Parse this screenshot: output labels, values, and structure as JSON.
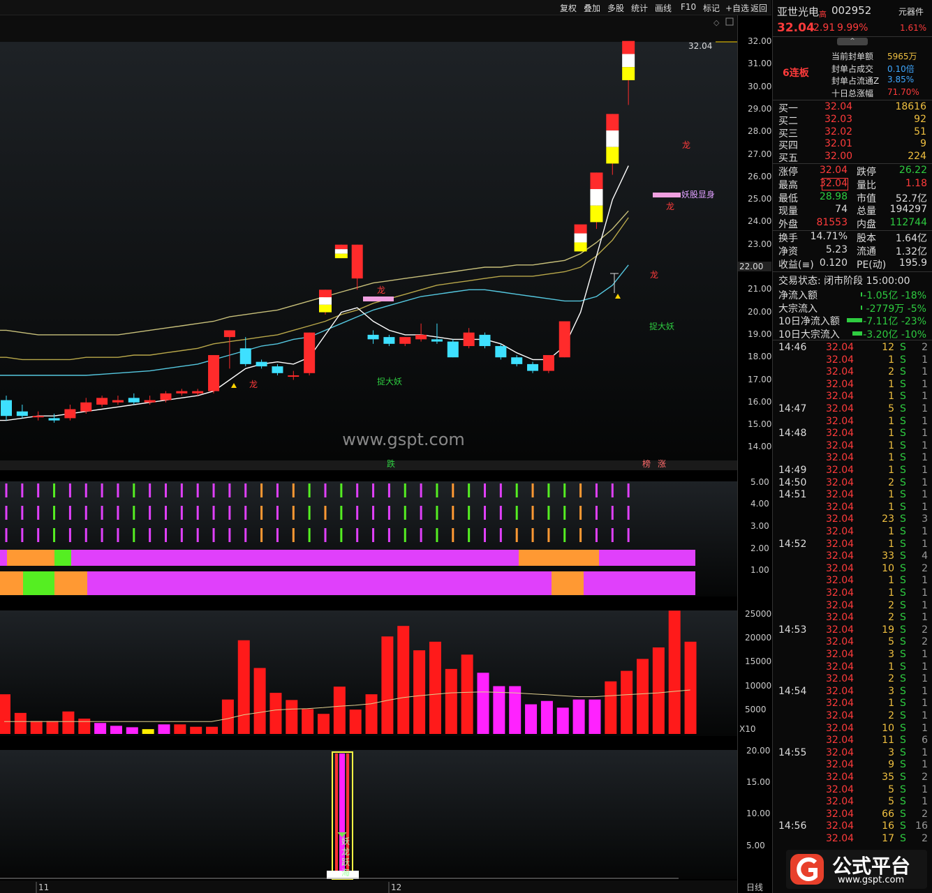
{
  "toolbar": {
    "items": [
      "复权",
      "叠加",
      "多股",
      "统计",
      "画线",
      "F10",
      "标记",
      "+自选",
      "返回"
    ]
  },
  "stock": {
    "name": "亚世光电",
    "tag": "高",
    "code": "002952",
    "sector": "元器件",
    "price": "32.04",
    "change": "2.91",
    "pct": "9.99%",
    "sector_pct": "1.61%"
  },
  "seal": {
    "badge": "6连板",
    "rows": [
      {
        "label": "当前封单额",
        "value": "5965万",
        "color": "gold"
      },
      {
        "label": "封单占成交",
        "value": "0.10倍",
        "color": "blue"
      },
      {
        "label": "封单占流通Z",
        "value": "3.85%",
        "color": "blue"
      },
      {
        "label": "十日总涨幅",
        "value": "71.70%",
        "color": "red"
      }
    ]
  },
  "bids": [
    {
      "label": "买一",
      "price": "32.04",
      "vol": "18616"
    },
    {
      "label": "买二",
      "price": "32.03",
      "vol": "92"
    },
    {
      "label": "买三",
      "price": "32.02",
      "vol": "51"
    },
    {
      "label": "买四",
      "price": "32.01",
      "vol": "9"
    },
    {
      "label": "买五",
      "price": "32.00",
      "vol": "224"
    }
  ],
  "stats1": [
    {
      "l1": "涨停",
      "v1": "32.04",
      "c1": "red",
      "l2": "跌停",
      "v2": "26.22",
      "c2": "green"
    },
    {
      "l1": "最高",
      "v1": "32.04",
      "c1": "red",
      "l2": "量比",
      "v2": "1.18",
      "c2": "red"
    },
    {
      "l1": "最低",
      "v1": "28.98",
      "c1": "green",
      "l2": "市值",
      "v2": "52.7亿",
      "c2": "white"
    },
    {
      "l1": "现量",
      "v1": "74",
      "c1": "white",
      "l2": "总量",
      "v2": "194297",
      "c2": "white"
    },
    {
      "l1": "外盘",
      "v1": "81553",
      "c1": "red",
      "l2": "内盘",
      "v2": "112744",
      "c2": "green"
    }
  ],
  "stats2": [
    {
      "l1": "换手",
      "v1": "14.71%",
      "c1": "white",
      "l2": "股本",
      "v2": "1.64亿",
      "c2": "white"
    },
    {
      "l1": "净资",
      "v1": "5.23",
      "c1": "white",
      "l2": "流通",
      "v2": "1.32亿",
      "c2": "white"
    },
    {
      "l1": "收益(≡)",
      "v1": "0.120",
      "c1": "white",
      "l2": "PE(动)",
      "v2": "195.9",
      "c2": "white"
    }
  ],
  "trade_status": "交易状态: 闭市阶段 15:00:00",
  "flows": [
    {
      "label": "净流入额",
      "value": "-1.05亿 -18%",
      "bar": 2
    },
    {
      "label": "大宗流入",
      "value": "-2779万 -5%",
      "bar": 2
    },
    {
      "label": "10日净流入额",
      "value": "-7.11亿 -23%",
      "bar": 22
    },
    {
      "label": "10日大宗流入",
      "value": "-3.20亿 -10%",
      "bar": 14
    }
  ],
  "ticks": [
    {
      "t": "14:46",
      "p": "32.04",
      "v": "12",
      "s": "S",
      "n": "2"
    },
    {
      "t": "",
      "p": "32.04",
      "v": "1",
      "s": "S",
      "n": "1"
    },
    {
      "t": "",
      "p": "32.04",
      "v": "2",
      "s": "S",
      "n": "1"
    },
    {
      "t": "",
      "p": "32.04",
      "v": "1",
      "s": "S",
      "n": "1"
    },
    {
      "t": "",
      "p": "32.04",
      "v": "1",
      "s": "S",
      "n": "1"
    },
    {
      "t": "14:47",
      "p": "32.04",
      "v": "5",
      "s": "S",
      "n": "1"
    },
    {
      "t": "",
      "p": "32.04",
      "v": "1",
      "s": "S",
      "n": "1"
    },
    {
      "t": "14:48",
      "p": "32.04",
      "v": "1",
      "s": "S",
      "n": "1"
    },
    {
      "t": "",
      "p": "32.04",
      "v": "1",
      "s": "S",
      "n": "1"
    },
    {
      "t": "",
      "p": "32.04",
      "v": "1",
      "s": "S",
      "n": "1"
    },
    {
      "t": "14:49",
      "p": "32.04",
      "v": "1",
      "s": "S",
      "n": "1"
    },
    {
      "t": "14:50",
      "p": "32.04",
      "v": "2",
      "s": "S",
      "n": "1"
    },
    {
      "t": "14:51",
      "p": "32.04",
      "v": "1",
      "s": "S",
      "n": "1"
    },
    {
      "t": "",
      "p": "32.04",
      "v": "1",
      "s": "S",
      "n": "1"
    },
    {
      "t": "",
      "p": "32.04",
      "v": "23",
      "s": "S",
      "n": "3"
    },
    {
      "t": "",
      "p": "32.04",
      "v": "1",
      "s": "S",
      "n": "1"
    },
    {
      "t": "14:52",
      "p": "32.04",
      "v": "1",
      "s": "S",
      "n": "1"
    },
    {
      "t": "",
      "p": "32.04",
      "v": "33",
      "s": "S",
      "n": "4"
    },
    {
      "t": "",
      "p": "32.04",
      "v": "10",
      "s": "S",
      "n": "2"
    },
    {
      "t": "",
      "p": "32.04",
      "v": "1",
      "s": "S",
      "n": "1"
    },
    {
      "t": "",
      "p": "32.04",
      "v": "1",
      "s": "S",
      "n": "1"
    },
    {
      "t": "",
      "p": "32.04",
      "v": "2",
      "s": "S",
      "n": "1"
    },
    {
      "t": "",
      "p": "32.04",
      "v": "2",
      "s": "S",
      "n": "1"
    },
    {
      "t": "14:53",
      "p": "32.04",
      "v": "19",
      "s": "S",
      "n": "2"
    },
    {
      "t": "",
      "p": "32.04",
      "v": "5",
      "s": "S",
      "n": "2"
    },
    {
      "t": "",
      "p": "32.04",
      "v": "3",
      "s": "S",
      "n": "1"
    },
    {
      "t": "",
      "p": "32.04",
      "v": "1",
      "s": "S",
      "n": "1"
    },
    {
      "t": "",
      "p": "32.04",
      "v": "2",
      "s": "S",
      "n": "1"
    },
    {
      "t": "14:54",
      "p": "32.04",
      "v": "3",
      "s": "S",
      "n": "1"
    },
    {
      "t": "",
      "p": "32.04",
      "v": "1",
      "s": "S",
      "n": "1"
    },
    {
      "t": "",
      "p": "32.04",
      "v": "2",
      "s": "S",
      "n": "1"
    },
    {
      "t": "",
      "p": "32.04",
      "v": "10",
      "s": "S",
      "n": "1"
    },
    {
      "t": "",
      "p": "32.04",
      "v": "11",
      "s": "S",
      "n": "6"
    },
    {
      "t": "14:55",
      "p": "32.04",
      "v": "3",
      "s": "S",
      "n": "1"
    },
    {
      "t": "",
      "p": "32.04",
      "v": "9",
      "s": "S",
      "n": "1"
    },
    {
      "t": "",
      "p": "32.04",
      "v": "35",
      "s": "S",
      "n": "2"
    },
    {
      "t": "",
      "p": "32.04",
      "v": "5",
      "s": "S",
      "n": "1"
    },
    {
      "t": "",
      "p": "32.04",
      "v": "5",
      "s": "S",
      "n": "1"
    },
    {
      "t": "",
      "p": "32.04",
      "v": "66",
      "s": "S",
      "n": "2"
    },
    {
      "t": "14:56",
      "p": "32.04",
      "v": "16",
      "s": "S",
      "n": "16"
    },
    {
      "t": "",
      "p": "32.04",
      "v": "17",
      "s": "S",
      "n": "2"
    }
  ],
  "axis": {
    "price": [
      "32.00",
      "31.00",
      "30.00",
      "29.00",
      "28.00",
      "27.00",
      "26.00",
      "25.00",
      "24.00",
      "23.00",
      "22.00",
      "21.00",
      "20.00",
      "19.00",
      "18.00",
      "17.00",
      "16.00",
      "15.00",
      "14.00"
    ],
    "price_current": "22.00",
    "ind1": [
      "5.00",
      "4.00",
      "3.00",
      "2.00",
      "1.00"
    ],
    "vol": [
      "25000",
      "20000",
      "15000",
      "10000",
      "5000"
    ],
    "vol_unit": "X10",
    "ind2": [
      "20.00",
      "15.00",
      "10.00",
      "5.00"
    ],
    "period": "日线",
    "dates": [
      "11",
      "12"
    ]
  },
  "annotations": {
    "max_price": "32.04",
    "watermark": "www.gspt.com",
    "long": "龙",
    "catch": "捉大妖",
    "yao": "妖股显身",
    "die": "跌",
    "bang": "榜",
    "zhang": "涨",
    "ind_text": "妖龙跃海"
  },
  "logo": {
    "name": "公式平台",
    "url": "www.gspt.com"
  },
  "colors": {
    "up": "#ff2b2b",
    "down": "#3ee0ff",
    "limit": "#ffff00",
    "bg": "#000000",
    "magenta": "#e040fb",
    "orange": "#ff9933",
    "lime": "#55ee22"
  },
  "chart_data": {
    "type": "candlestick",
    "ohlc": [
      {
        "o": 16.1,
        "h": 16.3,
        "l": 15.2,
        "c": 15.4
      },
      {
        "o": 15.6,
        "h": 15.9,
        "l": 15.3,
        "c": 15.4
      },
      {
        "o": 15.4,
        "h": 15.6,
        "l": 15.2,
        "c": 15.4
      },
      {
        "o": 15.3,
        "h": 15.5,
        "l": 15.1,
        "c": 15.2
      },
      {
        "o": 15.3,
        "h": 15.9,
        "l": 15.2,
        "c": 15.7
      },
      {
        "o": 15.6,
        "h": 16.2,
        "l": 15.5,
        "c": 16.0
      },
      {
        "o": 15.9,
        "h": 16.3,
        "l": 15.8,
        "c": 16.2
      },
      {
        "o": 16.0,
        "h": 16.3,
        "l": 15.9,
        "c": 16.1
      },
      {
        "o": 16.2,
        "h": 16.4,
        "l": 15.9,
        "c": 16.0
      },
      {
        "o": 16.0,
        "h": 16.3,
        "l": 15.9,
        "c": 16.1
      },
      {
        "o": 16.1,
        "h": 16.5,
        "l": 16.0,
        "c": 16.4
      },
      {
        "o": 16.4,
        "h": 16.6,
        "l": 16.3,
        "c": 16.5
      },
      {
        "o": 16.4,
        "h": 16.6,
        "l": 16.3,
        "c": 16.5
      },
      {
        "o": 16.5,
        "h": 18.1,
        "l": 16.4,
        "c": 18.1
      },
      {
        "o": 18.9,
        "h": 19.2,
        "l": 17.5,
        "c": 19.2
      },
      {
        "o": 18.4,
        "h": 18.9,
        "l": 17.6,
        "c": 17.7
      },
      {
        "o": 17.8,
        "h": 17.9,
        "l": 17.5,
        "c": 17.6
      },
      {
        "o": 17.6,
        "h": 17.7,
        "l": 17.2,
        "c": 17.3
      },
      {
        "o": 17.2,
        "h": 17.4,
        "l": 17.0,
        "c": 17.2
      },
      {
        "o": 17.3,
        "h": 19.1,
        "l": 17.2,
        "c": 19.1
      },
      {
        "o": 20.0,
        "h": 21.0,
        "l": 19.9,
        "c": 21.0
      },
      {
        "o": 23.0,
        "h": 23.0,
        "l": 22.4,
        "c": 22.4
      },
      {
        "o": 21.5,
        "h": 23.0,
        "l": 21.0,
        "c": 23.0
      },
      {
        "o": 19.0,
        "h": 19.2,
        "l": 18.6,
        "c": 18.8
      },
      {
        "o": 18.9,
        "h": 19.0,
        "l": 18.5,
        "c": 18.6
      },
      {
        "o": 18.6,
        "h": 18.9,
        "l": 18.5,
        "c": 18.9
      },
      {
        "o": 18.8,
        "h": 19.5,
        "l": 18.7,
        "c": 19.0
      },
      {
        "o": 18.8,
        "h": 19.5,
        "l": 18.6,
        "c": 18.7
      },
      {
        "o": 18.7,
        "h": 18.8,
        "l": 18.0,
        "c": 18.0
      },
      {
        "o": 18.5,
        "h": 19.3,
        "l": 18.4,
        "c": 19.1
      },
      {
        "o": 19.0,
        "h": 19.1,
        "l": 18.4,
        "c": 18.5
      },
      {
        "o": 18.5,
        "h": 18.6,
        "l": 17.9,
        "c": 18.0
      },
      {
        "o": 18.0,
        "h": 18.1,
        "l": 17.6,
        "c": 17.7
      },
      {
        "o": 17.7,
        "h": 17.8,
        "l": 17.3,
        "c": 17.4
      },
      {
        "o": 17.4,
        "h": 18.1,
        "l": 17.3,
        "c": 18.1
      },
      {
        "o": 18.0,
        "h": 19.6,
        "l": 18.0,
        "c": 19.6
      },
      {
        "o": 22.7,
        "h": 23.5,
        "l": 22.7,
        "c": 23.9
      },
      {
        "o": 24.0,
        "h": 26.2,
        "l": 23.7,
        "c": 26.2
      },
      {
        "o": 26.6,
        "h": 28.8,
        "l": 26.1,
        "c": 28.8
      },
      {
        "o": 30.3,
        "h": 32.0,
        "l": 29.2,
        "c": 32.04
      }
    ],
    "ma_white": [
      15.2,
      15.3,
      15.4,
      15.4,
      15.5,
      15.6,
      15.7,
      15.8,
      15.9,
      16.0,
      16.1,
      16.2,
      16.3,
      16.5,
      17.0,
      17.5,
      17.7,
      17.8,
      17.7,
      18.0,
      19.0,
      20.0,
      20.2,
      19.6,
      19.2,
      19.0,
      19.0,
      18.9,
      18.8,
      18.8,
      18.8,
      18.6,
      18.2,
      17.9,
      17.9,
      18.5,
      20.0,
      22.5,
      25.0,
      26.5
    ],
    "ma_cyan": [
      17.2,
      17.2,
      17.2,
      17.2,
      17.2,
      17.2,
      17.25,
      17.3,
      17.35,
      17.4,
      17.5,
      17.6,
      17.7,
      17.9,
      18.1,
      18.3,
      18.5,
      18.6,
      18.8,
      18.9,
      19.2,
      19.5,
      19.8,
      20.1,
      20.3,
      20.5,
      20.7,
      20.8,
      20.9,
      21.0,
      21.0,
      20.9,
      20.8,
      20.7,
      20.6,
      20.5,
      20.5,
      20.7,
      21.2,
      22.1
    ],
    "ma_yellow": [
      18.0,
      17.9,
      17.9,
      17.9,
      17.9,
      18.0,
      18.0,
      18.0,
      18.1,
      18.1,
      18.2,
      18.3,
      18.4,
      18.6,
      18.7,
      18.8,
      18.9,
      19.0,
      19.2,
      19.4,
      19.6,
      19.9,
      20.1,
      20.4,
      20.6,
      20.8,
      21.0,
      21.2,
      21.3,
      21.4,
      21.5,
      21.6,
      21.6,
      21.6,
      21.7,
      21.8,
      22.0,
      22.5,
      23.2,
      24.2
    ],
    "ma_gold": [
      19.2,
      19.1,
      19.0,
      19.0,
      19.0,
      19.0,
      19.0,
      19.0,
      19.1,
      19.2,
      19.3,
      19.4,
      19.5,
      19.6,
      19.8,
      19.9,
      20.0,
      20.1,
      20.3,
      20.5,
      20.7,
      20.9,
      21.1,
      21.3,
      21.4,
      21.5,
      21.6,
      21.7,
      21.8,
      21.9,
      22.0,
      22.0,
      22.1,
      22.1,
      22.2,
      22.3,
      22.6,
      23.1,
      23.7,
      24.5
    ],
    "volume": [
      8300,
      4400,
      2700,
      2700,
      4700,
      3200,
      2300,
      1700,
      1400,
      1000,
      2000,
      2000,
      1500,
      1500,
      7200,
      19600,
      13800,
      8600,
      7100,
      5200,
      4200,
      9900,
      5100,
      8300,
      20400,
      22600,
      17500,
      19300,
      13600,
      16600,
      12800,
      10000,
      10000,
      6200,
      6900,
      5500,
      7200,
      7200,
      11000,
      13200,
      15700,
      18100,
      25800,
      19300
    ],
    "volume_colors": [
      "r",
      "r",
      "r",
      "r",
      "r",
      "r",
      "m",
      "m",
      "m",
      "y",
      "m",
      "r",
      "r",
      "r",
      "r",
      "r",
      "r",
      "r",
      "r",
      "r",
      "r",
      "r",
      "r",
      "r",
      "r",
      "r",
      "r",
      "r",
      "r",
      "r",
      "m",
      "m",
      "m",
      "m",
      "m",
      "m",
      "m",
      "m",
      "r",
      "r",
      "r",
      "r",
      "r",
      "r"
    ]
  }
}
